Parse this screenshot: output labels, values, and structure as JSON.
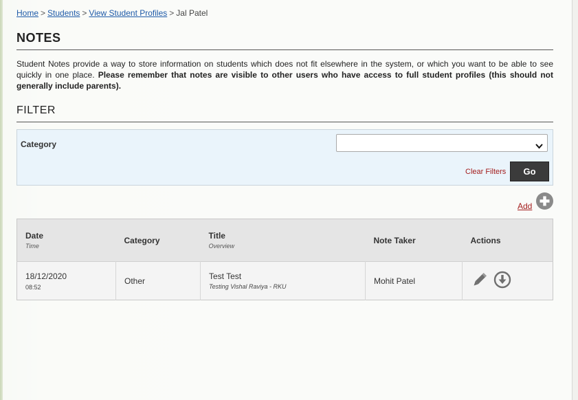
{
  "breadcrumb": {
    "home": "Home",
    "students": "Students",
    "profiles": "View Student Profiles",
    "current": "Jal Patel",
    "separator": ">"
  },
  "page": {
    "title": "NOTES",
    "description_plain": "Student Notes provide a way to store information on students which does not fit elsewhere in the system, or which you want to be able to see quickly in one place. ",
    "description_bold": "Please remember that notes are visible to other users who have access to full student profiles (this should not generally include parents)."
  },
  "filter": {
    "title": "FILTER",
    "category_label": "Category",
    "category_value": "",
    "clear_label": "Clear Filters",
    "go_label": "Go"
  },
  "add": {
    "label": "Add",
    "icon": "plus-circle-icon"
  },
  "table": {
    "headers": {
      "date": "Date",
      "date_sub": "Time",
      "category": "Category",
      "title": "Title",
      "title_sub": "Overview",
      "note_taker": "Note Taker",
      "actions": "Actions"
    },
    "rows": [
      {
        "date": "18/12/2020",
        "time": "08:52",
        "category": "Other",
        "title": "Test Test",
        "overview": "Testing  Vishal Raviya - RKU",
        "note_taker": "Mohit Patel",
        "actions": [
          "pencil-icon",
          "download-circle-icon"
        ]
      }
    ]
  },
  "colors": {
    "link": "#1e5aa8",
    "accent_red": "#a31c1c",
    "go_button": "#3b3b3b",
    "filter_bg": "#eaf4fb"
  }
}
